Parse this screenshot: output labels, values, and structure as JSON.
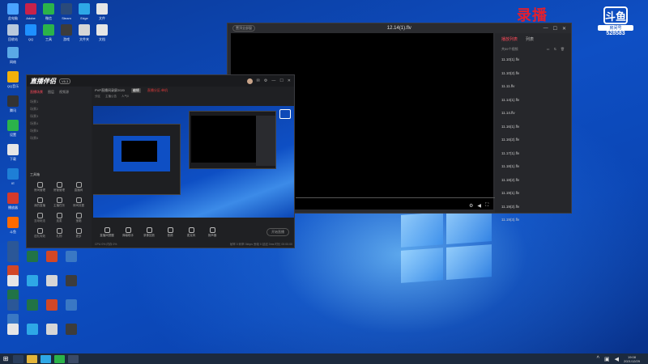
{
  "watermark": {
    "record_label": "录播",
    "douyu_logo": "斗鱼",
    "room_label": "房间号",
    "room_number": "528583"
  },
  "player": {
    "pin_label": "置顶全部窗",
    "title": "12.14(1).flv",
    "playlist_tabs": [
      "播放列表",
      "列表"
    ],
    "playlist_count": "共59个视频",
    "playlist_items": [
      "11.10(1).flv",
      "11.10(2).flv",
      "11.11.flv",
      "11.14(1).flv",
      "11.14.flv",
      "11.16(1).flv",
      "11.16(2).flv",
      "11.17(1).flv",
      "11.18(1).flv",
      "11.18(2).flv",
      "11.19(1).flv",
      "11.19(2).flv",
      "11.19(3).flv"
    ]
  },
  "recorder": {
    "logo": "直播伴侣",
    "version": "V6.3",
    "side_tabs": [
      "直播场景",
      "图层",
      "视频源"
    ],
    "scenes": [
      "场景1",
      "场景2",
      "场景3",
      "场景4",
      "场景5",
      "场景6"
    ],
    "tools_title": "工具箱",
    "tools": [
      "房间管理",
      "房管管理",
      "直播间",
      "我的直播",
      "主播任务",
      "房间设置",
      "互动玩法",
      "连麦",
      "宝箱",
      "送礼特效",
      "礼物",
      "更多"
    ],
    "info": {
      "title": "PVP直播间录屏2020",
      "tag": "编辑",
      "red": "直播分区:单机",
      "views": "0"
    },
    "substats": [
      "分区",
      "主播公告",
      "人气0"
    ],
    "bottom_buttons": [
      "直播间提醒",
      "弹幕助手",
      "录像回放",
      "音频",
      "麦克风",
      "扬声器"
    ],
    "start_label": "开始直播",
    "status_left": "CPU 0%  内存 0%",
    "status_right": "帧率 0  码率 0kbps  丢帧 0  延迟 0ms  时长 00:00:00"
  },
  "desktop_icons": [
    {
      "label": "此电脑",
      "color": "#4aa3ff"
    },
    {
      "label": "Adobe",
      "color": "#c7224a"
    },
    {
      "label": "微信",
      "color": "#2bb34a"
    },
    {
      "label": "Steam",
      "color": "#2a4a7a"
    },
    {
      "label": "Edge",
      "color": "#2ea8e6"
    },
    {
      "label": "文件",
      "color": "#e6e6e6"
    },
    {
      "label": "回收站",
      "color": "#b9c9dc"
    },
    {
      "label": "QQ",
      "color": "#1e90ff"
    },
    {
      "label": "工具",
      "color": "#2bb34a"
    },
    {
      "label": "游戏",
      "color": "#3c3c3c"
    },
    {
      "label": "文件夹",
      "color": "#d6d6d6"
    },
    {
      "label": "文档",
      "color": "#e6e6e6"
    },
    {
      "label": "网络",
      "color": "#5aa9e6"
    },
    {
      "label": "QQ音乐",
      "color": "#f2b10a"
    },
    {
      "label": "腾讯",
      "color": "#333"
    },
    {
      "label": "设置",
      "color": "#2bb34a"
    },
    {
      "label": "下载",
      "color": "#e6e6e6"
    },
    {
      "label": "IE",
      "color": "#1e7fd6"
    },
    {
      "label": "播放器",
      "color": "#d43a2a"
    },
    {
      "label": "斗鱼",
      "color": "#ff6a00"
    },
    {
      "label": "Word",
      "color": "#2b5797"
    },
    {
      "label": "PPT",
      "color": "#d24726"
    },
    {
      "label": "Excel",
      "color": "#217346"
    },
    {
      "label": "相册",
      "color": "#3a78c4"
    }
  ],
  "taskbar": {
    "time": "19:08",
    "date": "2021/12/29"
  }
}
